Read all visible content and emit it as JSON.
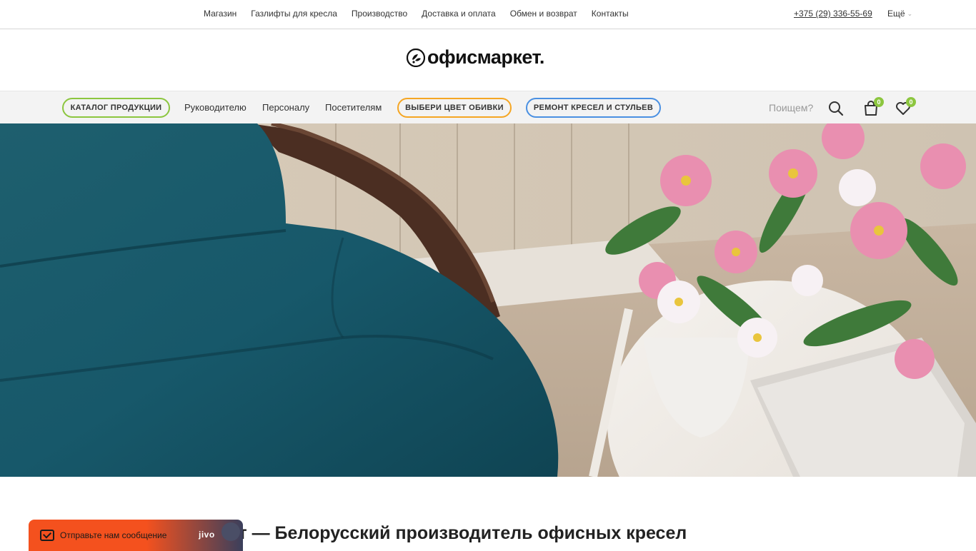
{
  "topbar": {
    "links": [
      "Магазин",
      "Газлифты для кресла",
      "Производство",
      "Доставка и оплата",
      "Обмен и возврат",
      "Контакты"
    ],
    "phone": "+375 (29) 336-55-69",
    "more_label": "Ещё"
  },
  "logo": {
    "text": "офисмаркет."
  },
  "mainnav": {
    "catalog": "КАТАЛОГ ПРОДУКЦИИ",
    "links": [
      "Руководителю",
      "Персоналу",
      "Посетителям"
    ],
    "color_pick": "ВЫБЕРИ ЦВЕТ ОБИВКИ",
    "repair": "РЕМОНТ КРЕСЕЛ И СТУЛЬЕВ",
    "search_placeholder": "Поищем?",
    "cart_count": "0",
    "wishlist_count": "0"
  },
  "main": {
    "heading": "маркет — Белорусский производитель офисных кресел"
  },
  "chat": {
    "label": "Отправьте нам сообщение",
    "brand": "jivo"
  },
  "colors": {
    "accent_green": "#8cc63f",
    "accent_orange": "#f5a623",
    "accent_blue": "#4a90e2",
    "chat_orange": "#f4511e"
  }
}
